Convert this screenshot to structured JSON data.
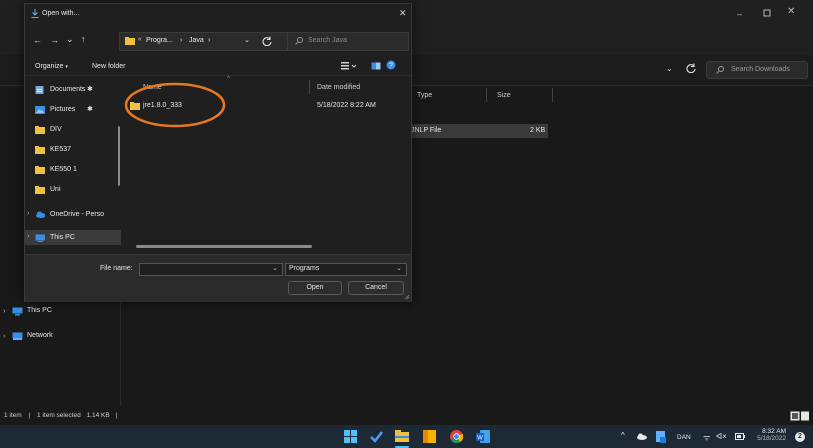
{
  "dialog": {
    "title": "Open with...",
    "breadcrumb": [
      "Progra...",
      "Java"
    ],
    "search_placeholder": "Search Java",
    "organize_label": "Organize",
    "new_folder_label": "New folder",
    "columns": {
      "name": "Name",
      "date": "Date modified"
    },
    "files": [
      {
        "name": "jre1.8.0_333",
        "date": "5/18/2022 8:22 AM"
      }
    ],
    "nav_items": [
      {
        "label": "Documents",
        "icon": "documents-icon",
        "pinned": true
      },
      {
        "label": "Pictures",
        "icon": "pictures-icon",
        "pinned": true
      },
      {
        "label": "DIV",
        "icon": "folder-icon"
      },
      {
        "label": "KE537",
        "icon": "folder-icon"
      },
      {
        "label": "KE550 1",
        "icon": "folder-icon"
      },
      {
        "label": "Uni",
        "icon": "folder-icon"
      },
      {
        "label": "OneDrive - Perso",
        "icon": "onedrive-icon"
      },
      {
        "label": "This PC",
        "icon": "this-pc-icon"
      }
    ],
    "file_name_label": "File name:",
    "file_name_value": "",
    "file_type_value": "Programs",
    "open_label": "Open",
    "cancel_label": "Cancel"
  },
  "explorer": {
    "search_placeholder": "Search Downloads",
    "columns": {
      "type": "Type",
      "size": "Size"
    },
    "selected_file": {
      "type": "JNLP File",
      "size": "2 KB"
    },
    "nav_items": [
      {
        "label": "This PC",
        "icon": "this-pc-icon"
      },
      {
        "label": "Network",
        "icon": "network-icon"
      }
    ],
    "status": {
      "items": "1 item",
      "selected": "1 item selected",
      "size": "1.14 KB"
    }
  },
  "taskbar": {
    "language": "DAN",
    "time": "8:32 AM",
    "date": "5/18/2022",
    "notification_count": "2"
  },
  "colors": {
    "accent": "#0078d4",
    "folder": "#f0c040",
    "annotation": "#e8781f"
  }
}
